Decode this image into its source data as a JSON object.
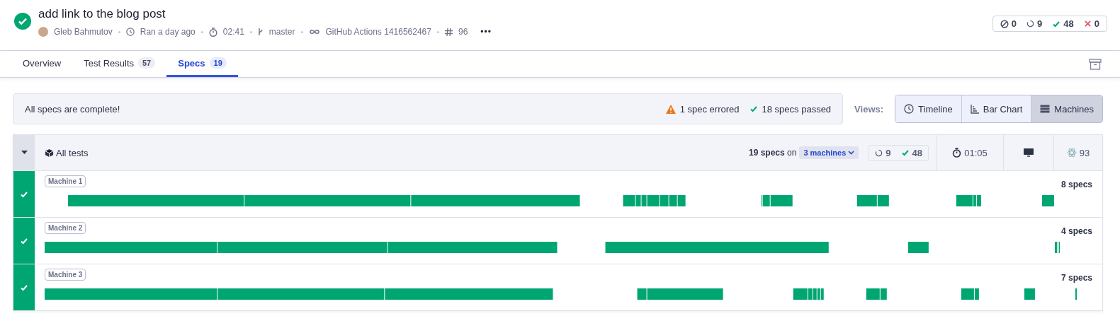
{
  "run": {
    "title": "add link to the blog post",
    "passed": true,
    "author": "Gleb Bahmutov",
    "time": "Ran a day ago",
    "duration": "02:41",
    "branch": "master",
    "ci": "GitHub Actions 1416562467",
    "number": "96",
    "more": "•••"
  },
  "counts": [
    {
      "kind": "skipped",
      "value": "0"
    },
    {
      "kind": "pending",
      "value": "9"
    },
    {
      "kind": "passed",
      "value": "48"
    },
    {
      "kind": "failed",
      "value": "0"
    }
  ],
  "tabs": [
    {
      "label": "Overview",
      "selected": false
    },
    {
      "label": "Test Results",
      "count": "57",
      "selected": false
    },
    {
      "label": "Specs",
      "count": "19",
      "selected": true
    }
  ],
  "banner": {
    "message": "All specs are complete!",
    "errored": "1 spec errored",
    "passed": "18 specs passed"
  },
  "views": {
    "label": "Views:",
    "options": [
      {
        "kind": "timeline",
        "label": "Timeline",
        "selected": false
      },
      {
        "kind": "bar",
        "label": "Bar Chart",
        "selected": false
      },
      {
        "kind": "machines",
        "label": "Machines",
        "selected": true
      }
    ]
  },
  "group": {
    "title": "All tests",
    "expanded": true,
    "specs": "19 specs",
    "on": "on",
    "machines": "3 machines",
    "pending": "9",
    "passed": "48",
    "duration": "01:05",
    "score": "93"
  },
  "machines": [
    {
      "label": "Machine 1",
      "specs": "8 specs",
      "passed": true
    },
    {
      "label": "Machine 2",
      "specs": "4 specs",
      "passed": true
    },
    {
      "label": "Machine 3",
      "specs": "7 specs",
      "passed": true
    }
  ]
}
